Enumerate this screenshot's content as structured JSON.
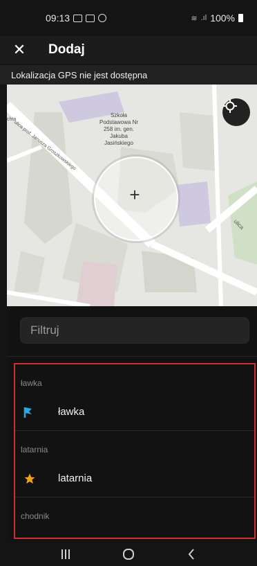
{
  "status_bar": {
    "time": "09:13",
    "battery": "100%"
  },
  "app_bar": {
    "title": "Dodaj",
    "close_icon": "close-icon"
  },
  "gps_banner": "Lokalizacja GPS nie jest dostępna",
  "map": {
    "poi": "Szkoła Podstawowa Nr 258 im. gen. Jakuba Jasińskiego",
    "street_1": "ulica prof. Janusza Groszkowskiego",
    "street_fragment_left": "chta",
    "street_fragment_right": "ulica",
    "locate_icon": "my-location-icon"
  },
  "filter": {
    "placeholder": "Filtruj"
  },
  "list": {
    "sections": [
      {
        "header": "ławka",
        "item_label": "ławka",
        "icon": "flag-icon",
        "icon_color": "#29a8e0"
      },
      {
        "header": "latarnia",
        "item_label": "latarnia",
        "icon": "star-icon",
        "icon_color": "#f0a01a"
      },
      {
        "header": "chodnik"
      }
    ],
    "highlight_color": "#d0302e"
  },
  "nav_bar": {
    "recents_icon": "recents-icon",
    "home_icon": "home-icon",
    "back_icon": "back-icon"
  }
}
